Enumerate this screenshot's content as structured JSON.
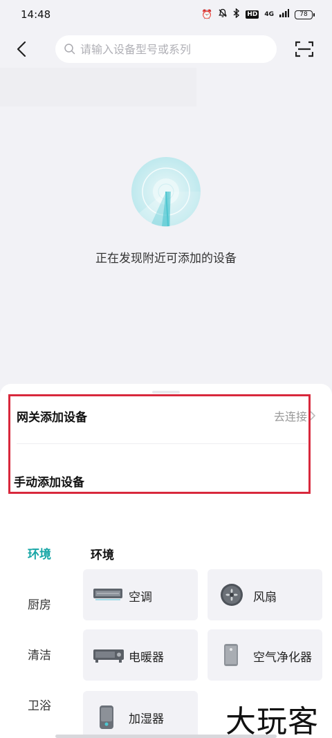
{
  "status_bar": {
    "time": "14:48",
    "hd": "HD",
    "network": "4G",
    "battery": "78"
  },
  "header": {
    "search_placeholder": "请输入设备型号或系列"
  },
  "discovery": {
    "text": "正在发现附近可添加的设备"
  },
  "gateway": {
    "title": "网关添加设备",
    "link_label": "去连接"
  },
  "manual": {
    "title": "手动添加设备"
  },
  "categories": [
    {
      "label": "环境",
      "active": true
    },
    {
      "label": "厨房",
      "active": false
    },
    {
      "label": "清洁",
      "active": false
    },
    {
      "label": "卫浴",
      "active": false
    }
  ],
  "section": {
    "title": "环境"
  },
  "devices": [
    {
      "label": "空调",
      "icon": "air-conditioner-icon"
    },
    {
      "label": "风扇",
      "icon": "fan-icon"
    },
    {
      "label": "电暖器",
      "icon": "electric-heater-icon"
    },
    {
      "label": "空气净化器",
      "icon": "air-purifier-icon"
    },
    {
      "label": "加湿器",
      "icon": "humidifier-icon"
    }
  ],
  "watermark": "大玩客",
  "colors": {
    "accent": "#17a6a6",
    "highlight_border": "#d8283c",
    "background": "#f2f2f6",
    "radar": "#4fc6d0"
  }
}
